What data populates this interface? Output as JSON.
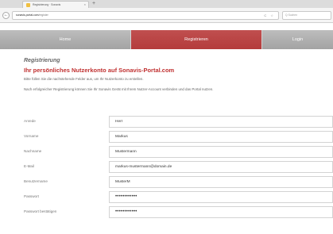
{
  "browser": {
    "tab_title": "Registrierung · Sonavis",
    "tab_close": "×",
    "new_tab": "+",
    "back": "←",
    "url_host": "sonavis-portal.com",
    "url_path": "/register",
    "url_actions": "C ☆",
    "search_placeholder": "Q  Suchen"
  },
  "nav": {
    "items": [
      {
        "label": "Home"
      },
      {
        "label": "Registrieren"
      },
      {
        "label": "Login"
      }
    ]
  },
  "page": {
    "title": "Registrierung",
    "subtitle": "Ihr persönliches Nutzerkonto auf Sonavis-Portal.com",
    "intro": "Bitte füllen Sie die nachstehende Felder aus, um Ihr Nutzerkonto zu erstellen.",
    "intro2": "Nach erfolgreicher Registrierung können Sie Ihr Sonavis Gerät mit Ihrem Nutzer-Account verbinden und das Portal nutzen."
  },
  "form": {
    "fields": [
      {
        "label": "Anrede",
        "value": "Herr"
      },
      {
        "label": "Vorname",
        "value": "Markus"
      },
      {
        "label": "Nachname",
        "value": "Mustermann"
      },
      {
        "label": "E-Mail",
        "value": "markus-mustermann@domain.de"
      },
      {
        "label": "Benutzername",
        "value": "MusterM"
      },
      {
        "label": "Passwort",
        "value": "••••••••••••"
      },
      {
        "label": "Passwort bestätigen",
        "value": "••••••••••••"
      }
    ]
  },
  "colors": {
    "accent": "#b94444",
    "nav_gray": "#b0b0b0"
  }
}
